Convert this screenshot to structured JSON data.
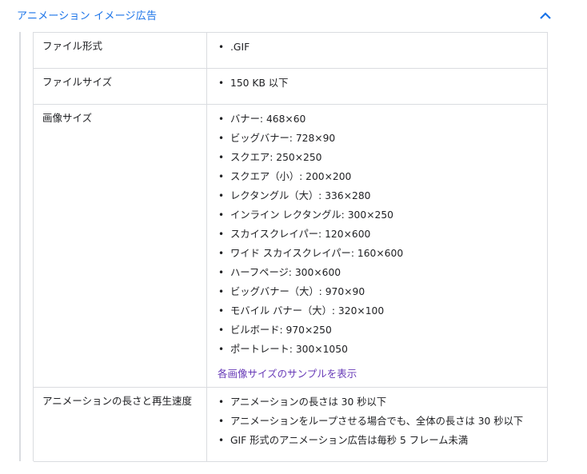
{
  "section": {
    "title": "アニメーション イメージ広告",
    "collapse_icon": "chevron-up-icon",
    "accent_color": "#1a73e8"
  },
  "table": {
    "rows": [
      {
        "label": "ファイル形式",
        "values": [
          ".GIF"
        ]
      },
      {
        "label": "ファイルサイズ",
        "values": [
          "150 KB 以下"
        ]
      },
      {
        "label": "画像サイズ",
        "values": [
          "バナー: 468×60",
          "ビッグバナー: 728×90",
          "スクエア: 250×250",
          "スクエア（小）: 200×200",
          "レクタングル（大）: 336×280",
          "インライン レクタングル: 300×250",
          "スカイスクレイパー: 120×600",
          "ワイド スカイスクレイパー: 160×600",
          "ハーフページ: 300×600",
          "ビッグバナー（大）: 970×90",
          "モバイル バナー（大）: 320×100",
          "ビルボード: 970×250",
          "ポートレート: 300×1050"
        ],
        "link": "各画像サイズのサンプルを表示"
      },
      {
        "label": "アニメーションの長さと再生速度",
        "values": [
          "アニメーションの長さは 30 秒以下",
          "アニメーションをループさせる場合でも、全体の長さは 30 秒以下",
          "GIF 形式のアニメーション広告は毎秒 5 フレーム未満"
        ]
      }
    ]
  },
  "link_color": "#673ab7"
}
